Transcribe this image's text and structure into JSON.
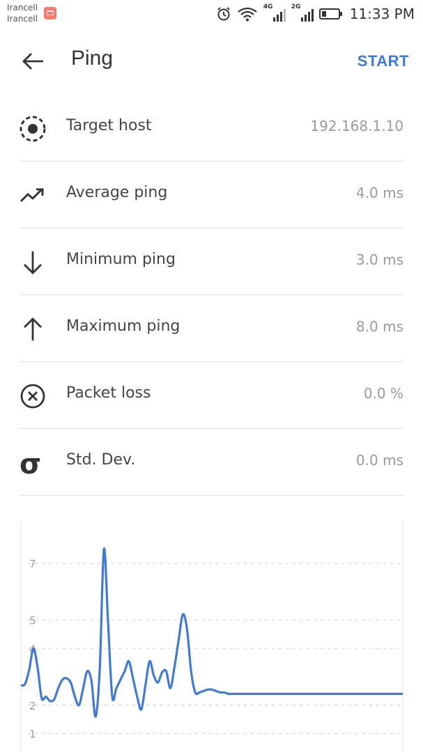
{
  "status_bar": {
    "carriers": [
      "Irancell",
      "Irancell"
    ],
    "network_1": "4G",
    "network_2": "2G",
    "time": "11:33 PM",
    "icons": [
      "mail-icon",
      "alarm-icon",
      "wifi-icon",
      "signal-icon",
      "battery-icon"
    ],
    "battery_level": 0.25
  },
  "app_bar": {
    "title": "Ping",
    "start_label": "START"
  },
  "stats": [
    {
      "icon": "target-icon",
      "label": "Target host",
      "value": "192.168.1.10"
    },
    {
      "icon": "trending-up-icon",
      "label": "Average ping",
      "value": "4.0 ms"
    },
    {
      "icon": "arrow-down-icon",
      "label": "Minimum ping",
      "value": "3.0 ms"
    },
    {
      "icon": "arrow-up-icon",
      "label": "Maximum ping",
      "value": "8.0 ms"
    },
    {
      "icon": "cancel-circle-icon",
      "label": "Packet loss",
      "value": "0.0 %"
    },
    {
      "icon": "sigma-icon",
      "label": "Std. Dev.",
      "value": "0.0 ms"
    }
  ],
  "colors": {
    "accent": "#3f7ad9",
    "line": "#3f7ad9",
    "text": "#333333",
    "value_text": "#9a9a9a",
    "divider": "#e3e3e3"
  },
  "chart_data": {
    "type": "line",
    "title": "",
    "xlabel": "",
    "ylabel": "",
    "y_ticks": [
      "1",
      "2",
      "4",
      "5",
      "7"
    ],
    "grid": "horizontal dashed",
    "legend": "none",
    "x": [
      0,
      1,
      2,
      3,
      4,
      5,
      6,
      7,
      8,
      9,
      10,
      11,
      12,
      13,
      14,
      15,
      16,
      17,
      18,
      19,
      20,
      21,
      22,
      23,
      24,
      25,
      26,
      27,
      28,
      29,
      30,
      31,
      32,
      33,
      34,
      35,
      36,
      37,
      38,
      39,
      40,
      41,
      42,
      43,
      44,
      45,
      46,
      47,
      48,
      49,
      50,
      51,
      52,
      53,
      54,
      55,
      56,
      57,
      58,
      59,
      60,
      61,
      62,
      63,
      64,
      65,
      66,
      67,
      68,
      69,
      70,
      71,
      72,
      73,
      74,
      75,
      76,
      77,
      78,
      79,
      80,
      81,
      82,
      83,
      84,
      85,
      86,
      87,
      88,
      89,
      90,
      91,
      92
    ],
    "values": [
      2.7,
      2.75,
      3.25,
      4.0,
      3.35,
      2.25,
      2.3,
      2.15,
      2.2,
      2.6,
      2.9,
      2.95,
      2.8,
      2.3,
      2.0,
      2.6,
      3.2,
      2.85,
      1.6,
      3.3,
      7.5,
      4.9,
      2.3,
      2.6,
      2.9,
      3.2,
      3.55,
      2.95,
      2.3,
      1.85,
      2.7,
      3.55,
      3.05,
      2.8,
      3.15,
      3.2,
      2.6,
      3.35,
      4.3,
      5.2,
      4.7,
      3.2,
      2.45,
      2.45,
      2.5,
      2.55,
      2.55,
      2.5,
      2.45,
      2.45,
      2.4,
      2.4,
      2.4,
      2.4,
      2.4,
      2.4,
      2.4,
      2.4,
      2.4,
      2.4,
      2.4,
      2.4,
      2.4,
      2.4,
      2.4,
      2.4,
      2.4,
      2.4,
      2.4,
      2.4,
      2.4,
      2.4,
      2.4,
      2.4,
      2.4,
      2.4,
      2.4,
      2.4,
      2.4,
      2.4,
      2.4,
      2.4,
      2.4,
      2.4,
      2.4,
      2.4,
      2.4,
      2.4,
      2.4,
      2.4,
      2.4,
      2.4,
      2.4
    ]
  }
}
